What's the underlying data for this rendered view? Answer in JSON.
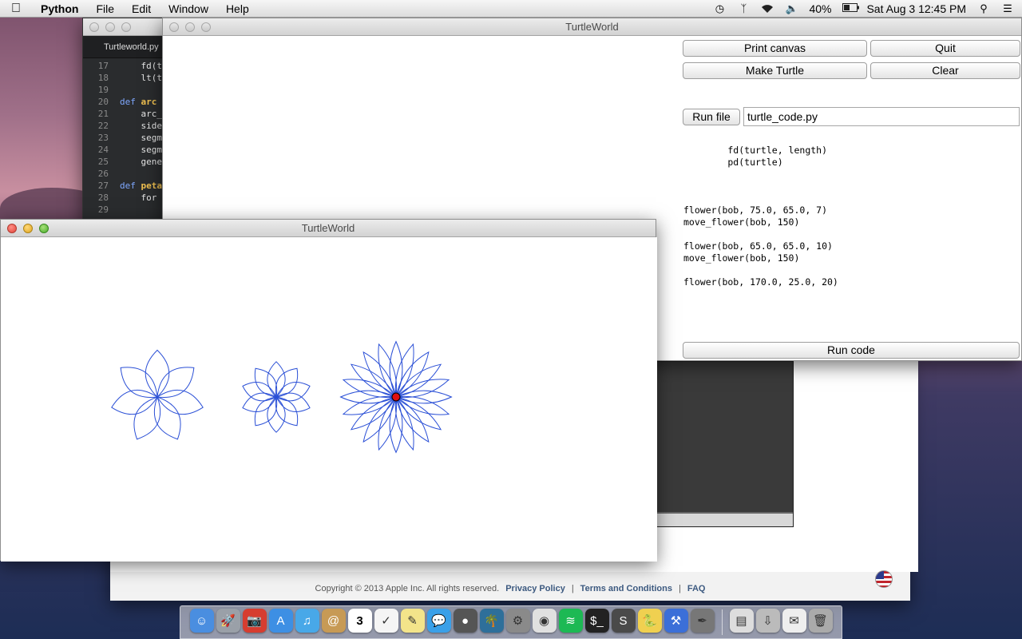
{
  "menubar": {
    "app_name": "Python",
    "menus": [
      "File",
      "Edit",
      "Window",
      "Help"
    ],
    "battery": "40%",
    "datetime": "Sat Aug 3  12:45 PM"
  },
  "editor": {
    "tab_title": "Turtleworld.py",
    "lines": [
      {
        "num": "17",
        "code": "    fd(t"
      },
      {
        "num": "18",
        "code": "    lt(t"
      },
      {
        "num": "19",
        "code": ""
      },
      {
        "num": "20",
        "kw": "def ",
        "fn": "arc",
        "code": ""
      },
      {
        "num": "21",
        "code": "    arc_"
      },
      {
        "num": "22",
        "code": "    side"
      },
      {
        "num": "23",
        "code": "    segm"
      },
      {
        "num": "24",
        "code": "    segm"
      },
      {
        "num": "25",
        "code": "    gene"
      },
      {
        "num": "26",
        "code": ""
      },
      {
        "num": "27",
        "kw": "def ",
        "fn": "peta",
        "code": ""
      },
      {
        "num": "28",
        "code": "    for"
      },
      {
        "num": "29",
        "code": ""
      }
    ]
  },
  "control_window": {
    "title": "TurtleWorld",
    "print_canvas": "Print canvas",
    "quit": "Quit",
    "make_turtle": "Make Turtle",
    "clear": "Clear",
    "run_file": "Run file",
    "file_value": "turtle_code.py",
    "code": "        fd(turtle, length)\n        pd(turtle)\n\n\n\nflower(bob, 75.0, 65.0, 7)\nmove_flower(bob, 150)\n\nflower(bob, 65.0, 65.0, 10)\nmove_flower(bob, 150)\n\nflower(bob, 170.0, 25.0, 20)",
    "run_code": "Run code"
  },
  "canvas_window": {
    "title": "TurtleWorld"
  },
  "flowers": [
    {
      "petals": 7,
      "radius": 75.0,
      "angle": 65.0
    },
    {
      "petals": 10,
      "radius": 65.0,
      "angle": 65.0
    },
    {
      "petals": 20,
      "radius": 170.0,
      "angle": 25.0
    }
  ],
  "colors": {
    "pen": "#2a4fd6",
    "turtle": "#e01010"
  },
  "browser_footer": {
    "copyright": "Copyright © 2013 Apple Inc. All rights reserved.",
    "privacy": "Privacy Policy",
    "terms": "Terms and Conditions",
    "faq": "FAQ"
  },
  "dock": [
    "finder",
    "launchpad",
    "photo-booth",
    "app-store",
    "itunes",
    "contacts",
    "calendar",
    "reminders",
    "notes",
    "messages",
    "facetime",
    "iphoto",
    "system-preferences",
    "chrome",
    "spotify",
    "terminal",
    "sublime-text",
    "python-launcher",
    "xcode",
    "pen-tool",
    "documents",
    "downloads",
    "mail-stack",
    "trash"
  ],
  "calendar_day": "3"
}
